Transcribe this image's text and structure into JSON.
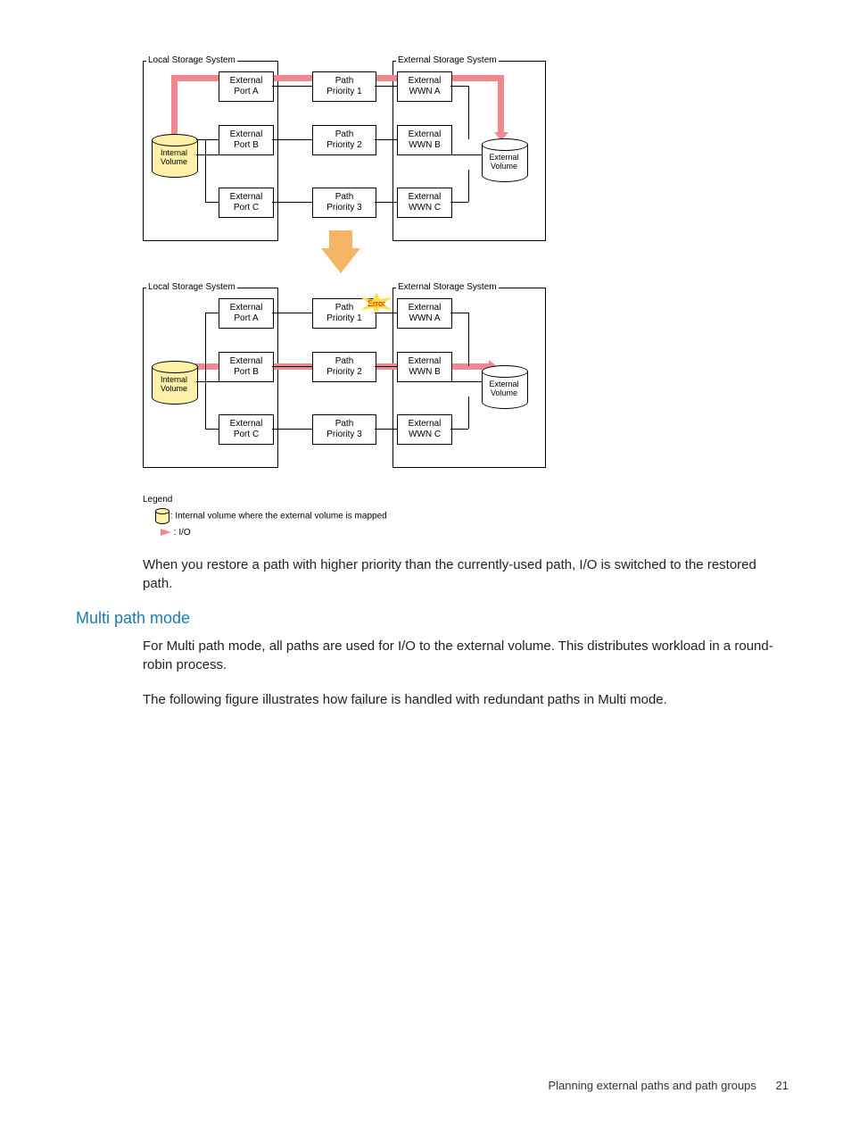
{
  "diagram1": {
    "local_label": "Local Storage System",
    "external_label": "External Storage System",
    "internal_volume": "Internal\nVolume",
    "external_volume": "External\nVolume",
    "ports": [
      {
        "port": "External\nPort A",
        "path": "Path\nPriority 1",
        "wwn": "External\nWWN A"
      },
      {
        "port": "External\nPort B",
        "path": "Path\nPriority 2",
        "wwn": "External\nWWN B"
      },
      {
        "port": "External\nPort C",
        "path": "Path\nPriority 3",
        "wwn": "External\nWWN C"
      }
    ]
  },
  "diagram2": {
    "local_label": "Local Storage System",
    "external_label": "External Storage System",
    "internal_volume": "Internal\nVolume",
    "external_volume": "External\nVolume",
    "error_label": "Error",
    "ports": [
      {
        "port": "External\nPort A",
        "path": "Path\nPriority 1",
        "wwn": "External\nWWN A"
      },
      {
        "port": "External\nPort B",
        "path": "Path\nPriority 2",
        "wwn": "External\nWWN B"
      },
      {
        "port": "External\nPort C",
        "path": "Path\nPriority 3",
        "wwn": "External\nWWN C"
      }
    ]
  },
  "legend": {
    "title": "Legend",
    "item1": ": Internal volume where the external volume is mapped",
    "item2": ": I/O"
  },
  "paragraph1": "When you restore a path with higher priority than the currently-used path, I/O is switched to the restored path.",
  "heading": "Multi path mode",
  "paragraph2": "For Multi path mode, all paths are used for I/O to the external volume. This distributes workload in a round-robin process.",
  "paragraph3": "The following figure illustrates how failure is handled with redundant paths in Multi mode.",
  "footer": {
    "text": "Planning external paths and path groups",
    "page": "21"
  }
}
